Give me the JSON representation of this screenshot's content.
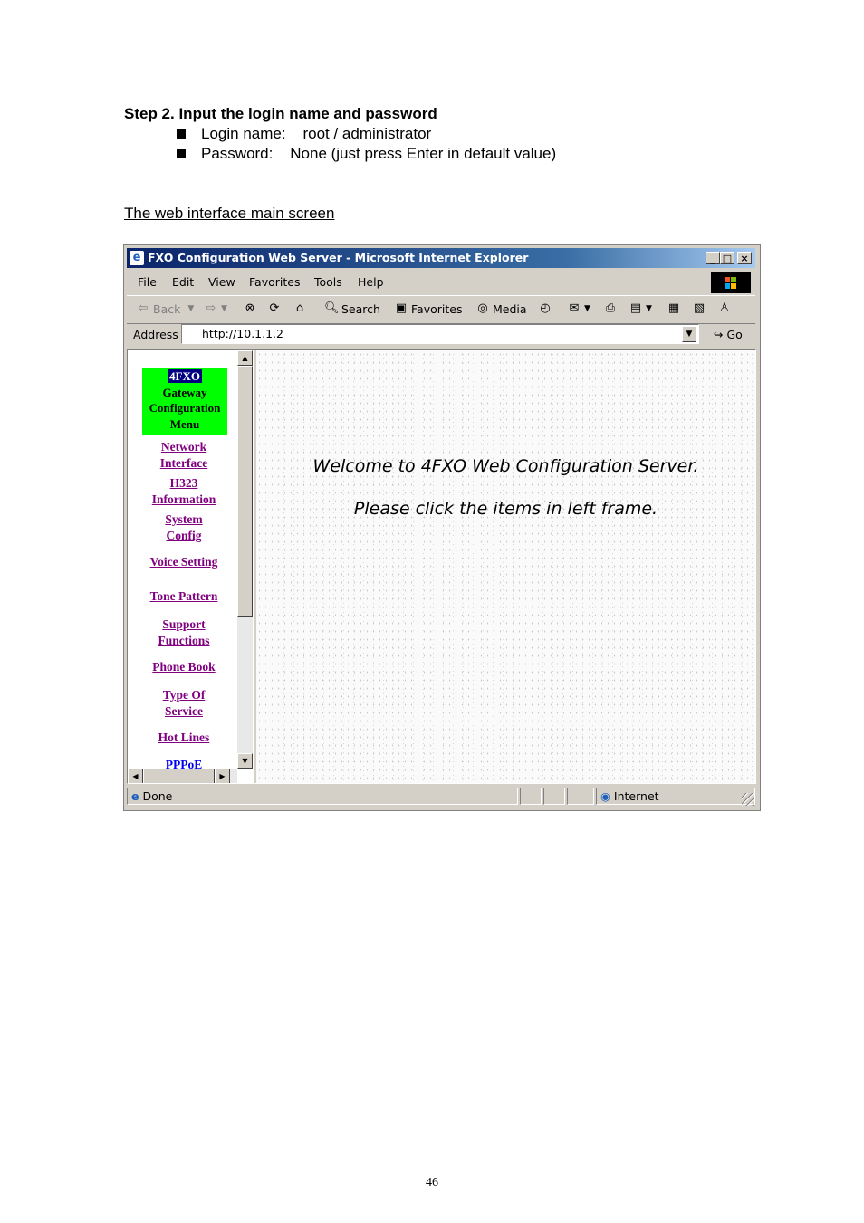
{
  "document": {
    "step_heading": "Step 2. Input the login name and password",
    "bullets": [
      "Login name:    root / administrator",
      "Password:    None (just press Enter in default value)"
    ],
    "caption": "The web interface main screen",
    "page_number": "46"
  },
  "browser": {
    "title_part1": "FXO Configuration Web Server",
    "title_part2": " - Microsoft Internet Explorer",
    "menu": [
      "File",
      "Edit",
      "View",
      "Favorites",
      "Tools",
      "Help"
    ],
    "toolbar": {
      "back": "Back",
      "search": "Search",
      "favorites": "Favorites",
      "media": "Media"
    },
    "address_label": "Address",
    "address_value": "http://10.1.1.2",
    "go_label": "Go",
    "status_text": "Done",
    "zone_text": "Internet"
  },
  "left_frame": {
    "menu_title": [
      "4FXO",
      "Gateway",
      "Configuration",
      "Menu"
    ],
    "links": [
      [
        "Network",
        "Interface"
      ],
      [
        "H323",
        "Information"
      ],
      [
        "System",
        "Config"
      ],
      [
        "Voice Setting"
      ],
      [
        "Tone Pattern"
      ],
      [
        "Support",
        "Functions"
      ],
      [
        "Phone Book"
      ],
      [
        "Type Of",
        "Service"
      ],
      [
        "Hot Lines"
      ],
      [
        "PPPoE"
      ]
    ]
  },
  "main_frame": {
    "welcome_line1": "Welcome to 4FXO Web Configuration Server.",
    "welcome_line2": "Please click the items in left frame."
  },
  "colors": {
    "title_bar": "#0a246a",
    "menu_highlight": "#00ff00",
    "visited_link": "#800080",
    "link": "#0000ee"
  }
}
